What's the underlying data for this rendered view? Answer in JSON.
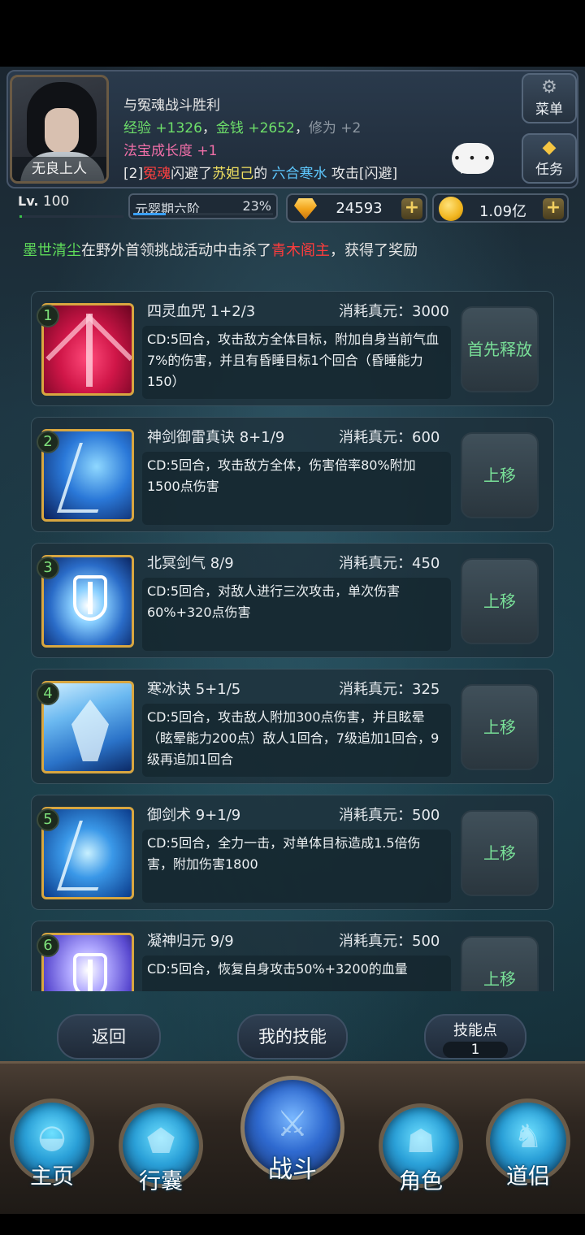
{
  "player": {
    "name": "无良上人",
    "level_prefix": "Lv.",
    "level": "100",
    "level_progress": 0.02,
    "realm": "元婴期六阶",
    "realm_percent": "23%",
    "realm_progress": 0.23
  },
  "battle_log": {
    "line1": "与冤魂战斗胜利",
    "exp_label": "经验",
    "exp_value": "+1326",
    "sep1": "，",
    "money_label": "金钱",
    "money_value": "+2652",
    "sep2": "，",
    "cultivation_label": "修为",
    "cultivation_value": "+2",
    "treasure_label": "法宝成长度",
    "treasure_value": "+1",
    "evade_prefix": "[2]",
    "evade_actor": "冤魂",
    "evade_mid": "闪避了",
    "evade_target": "苏妲己",
    "evade_of": "的",
    "evade_skill": "六合寒水",
    "evade_suffix": "攻击[闪避]"
  },
  "side_buttons": {
    "menu_label": "菜单",
    "menu_icon": "gear-icon",
    "task_label": "任务",
    "task_icon": "gem-icon",
    "chat_icon": "chat-bubble-icon",
    "chat_text": "• • •"
  },
  "currency": {
    "gems": "24593",
    "gold": "1.09亿",
    "plus": "+"
  },
  "notice": {
    "player": "墨世清尘",
    "mid": "在野外首领挑战活动中击杀了",
    "boss": "青木阁主",
    "end": "，获得了奖励"
  },
  "skills": [
    {
      "num": "1",
      "name": "四灵血咒 1+2/3",
      "cost": "消耗真元：3000",
      "desc": "CD:5回合，攻击敌方全体目标，附加自身当前气血7%的伤害，并且有昏睡目标1个回合（昏睡能力150）",
      "action": "首先释放"
    },
    {
      "num": "2",
      "name": "神剑御雷真诀 8+1/9",
      "cost": "消耗真元：600",
      "desc": "CD:5回合，攻击敌方全体，伤害倍率80%附加1500点伤害",
      "action": "上移"
    },
    {
      "num": "3",
      "name": "北冥剑气 8/9",
      "cost": "消耗真元：450",
      "desc": "CD:5回合，对敌人进行三次攻击，单次伤害60%+320点伤害",
      "action": "上移"
    },
    {
      "num": "4",
      "name": "寒冰诀 5+1/5",
      "cost": "消耗真元：325",
      "desc": "CD:5回合，攻击敌人附加300点伤害，并且眩晕（眩晕能力200点）敌人1回合，7级追加1回合，9级再追加1回合",
      "action": "上移"
    },
    {
      "num": "5",
      "name": "御剑术 9+1/9",
      "cost": "消耗真元：500",
      "desc": "CD:5回合，全力一击，对单体目标造成1.5倍伤害，附加伤害1800",
      "action": "上移"
    },
    {
      "num": "6",
      "name": "凝神归元 9/9",
      "cost": "消耗真元：500",
      "desc": "CD:5回合，恢复自身攻击50%+3200的血量",
      "action": "上移"
    }
  ],
  "bottom_buttons": {
    "back": "返回",
    "my_skills": "我的技能",
    "skill_points_label": "技能点",
    "skill_points_value": "1"
  },
  "nav": {
    "home": "主页",
    "bag": "行囊",
    "battle": "战斗",
    "role": "角色",
    "dao": "道侣"
  }
}
